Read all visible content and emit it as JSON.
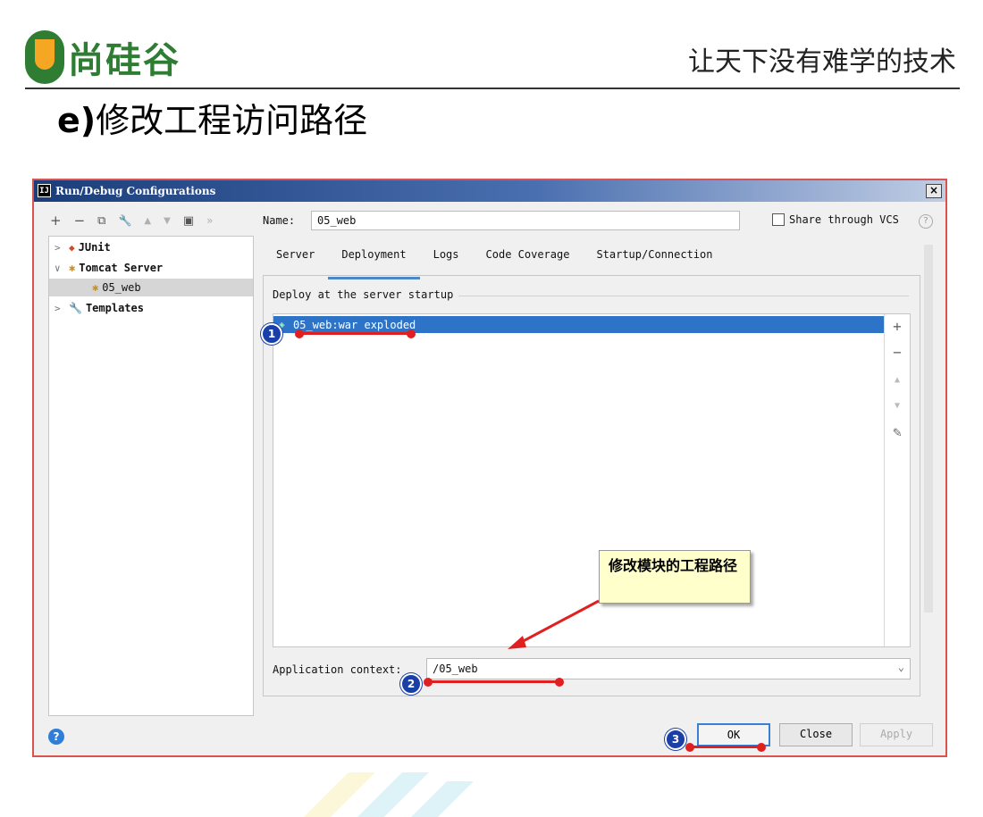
{
  "slide": {
    "logo_text": "尚硅谷",
    "slogan": "让天下没有难学的技术",
    "title_prefix": "e)",
    "title": "修改工程访问路径"
  },
  "dialog": {
    "title": "Run/Debug Configurations",
    "title_icon": "IJ",
    "close_label": "×"
  },
  "toolbar": {
    "add": "+",
    "remove": "−",
    "copy": "⧉",
    "edit": "🔧",
    "up": "▲",
    "down": "▼",
    "folder": "▣",
    "more": "»"
  },
  "tree": {
    "items": [
      {
        "label": "JUnit",
        "arrow": ">"
      },
      {
        "label": "Tomcat Server",
        "arrow": "∨"
      },
      {
        "label": "05_web"
      },
      {
        "label": "Templates",
        "arrow": ">"
      }
    ]
  },
  "name": {
    "label": "Name:",
    "value": "05_web"
  },
  "share": {
    "label": "Share through VCS",
    "checked": false,
    "help": "?"
  },
  "tabs": [
    "Server",
    "Deployment",
    "Logs",
    "Code Coverage",
    "Startup/Connection"
  ],
  "active_tab": "Deployment",
  "deploy": {
    "group_label": "Deploy at the server startup",
    "items": [
      "05_web:war exploded"
    ],
    "side_buttons": {
      "add": "+",
      "remove": "−",
      "up": "▲",
      "down": "▼",
      "edit": "✎"
    }
  },
  "context": {
    "label": "Application context:",
    "value": "/05_web",
    "dropdown": "⌄"
  },
  "buttons": {
    "help": "?",
    "ok": "OK",
    "close": "Close",
    "apply": "Apply"
  },
  "annotations": {
    "callout": "修改模块的工程路径",
    "badge1": "1",
    "badge2": "2",
    "badge3": "3"
  },
  "colors": {
    "brand_green": "#2e7d32",
    "brand_orange": "#f5a623",
    "selection_blue": "#2d74c8",
    "annotation_red": "#e02020",
    "badge_blue": "#1a3fa8"
  }
}
